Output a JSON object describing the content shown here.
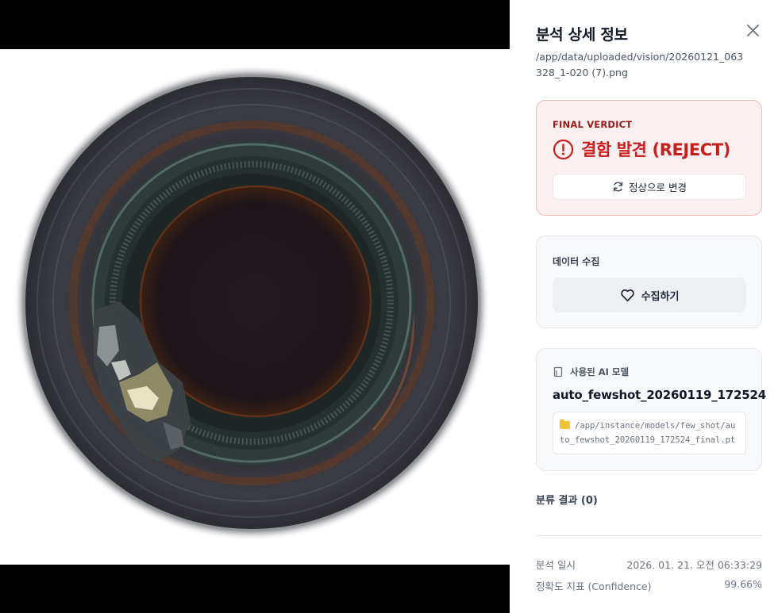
{
  "viewer": {
    "image_alt": "bottle-mouth-inspection-image"
  },
  "panel": {
    "title": "분석 상세 정보",
    "file_path": "/app/data/uploaded/vision/20260121_063328_1-020 (7).png",
    "verdict": {
      "label": "FINAL VERDICT",
      "text": "결함 발견 (REJECT)",
      "change_button": "정상으로 변경",
      "color": "#c81e1e"
    },
    "collect": {
      "label": "데이터 수집",
      "button": "수집하기"
    },
    "model": {
      "label": "사용된 AI 모델",
      "name": "auto_fewshot_20260119_172524",
      "path": "/app/instance/models/few_shot/auto_fewshot_20260119_172524_final.pt"
    },
    "classification": {
      "title": "분류 결과 (0)"
    },
    "meta": {
      "analyzed_at_label": "분석 일시",
      "analyzed_at_value": "2026. 01. 21. 오전 06:33:29",
      "confidence_label": "정확도 지표 (Confidence)",
      "confidence_value": "99.66%"
    }
  }
}
